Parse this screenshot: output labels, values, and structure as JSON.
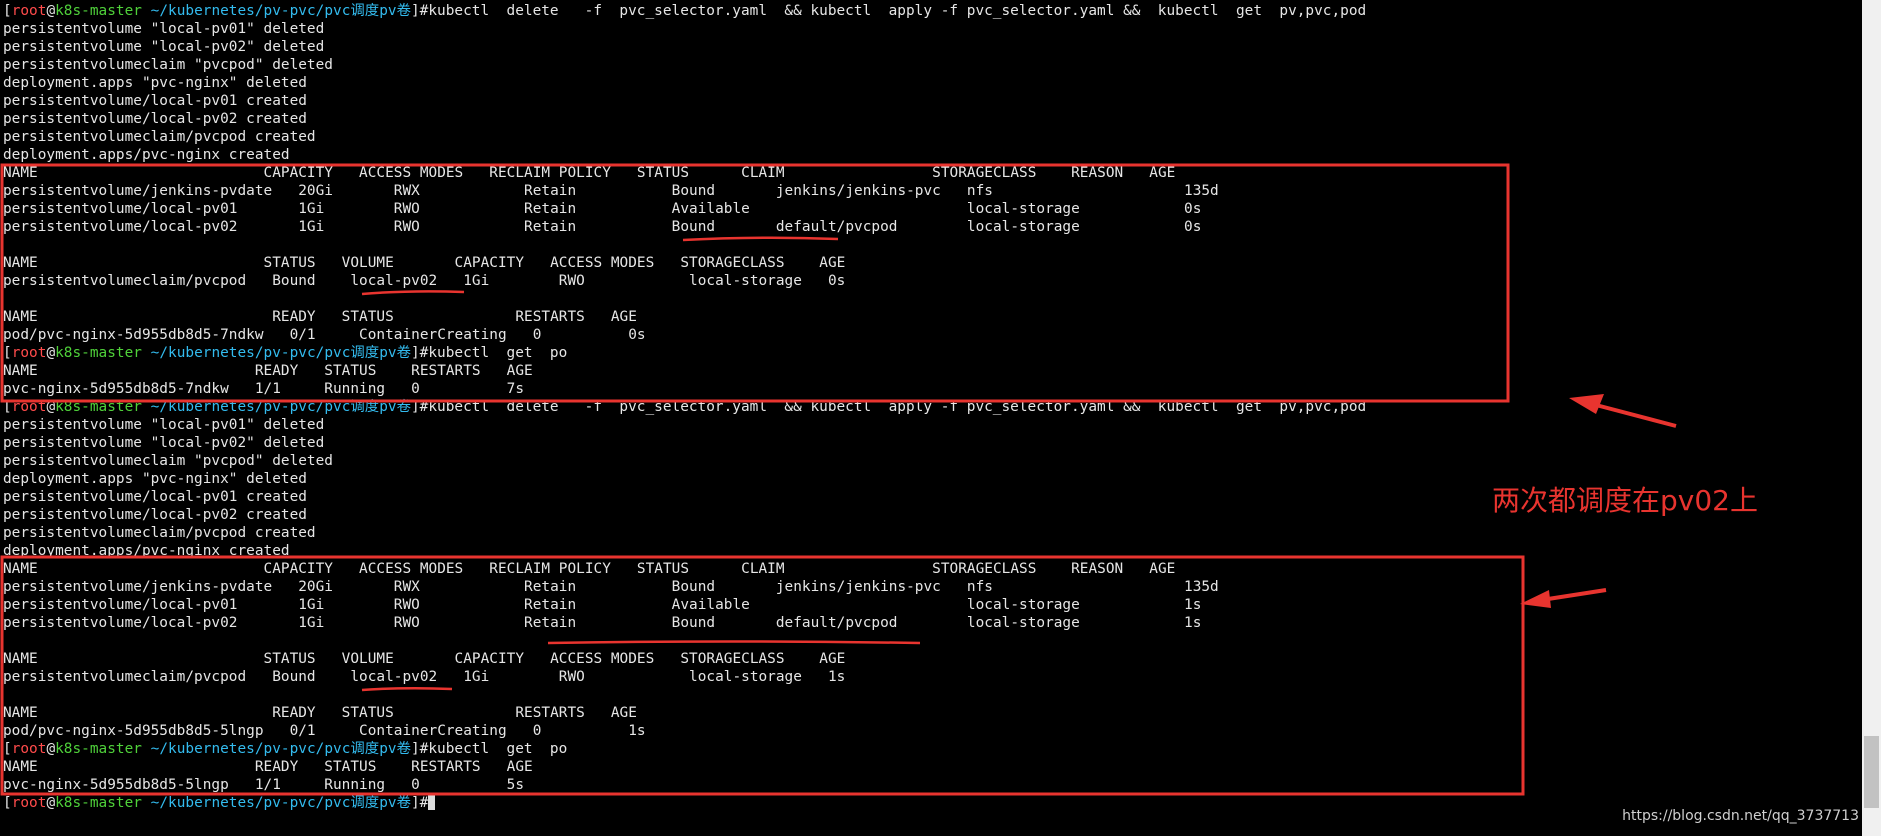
{
  "terminal": {
    "prompt": {
      "open": "[",
      "user": "root",
      "at": "@",
      "host": "k8s-master",
      "path": " ~/kubernetes/pv-pvc/pvc调度pv卷",
      "close": "]#"
    },
    "commands": {
      "apply": "kubectl  delete   -f  pvc_selector.yaml  && kubectl  apply -f pvc_selector.yaml &&  kubectl  get  pv,pvc,pod",
      "get_po": "kubectl  get  po"
    },
    "run1": {
      "out": [
        "persistentvolume \"local-pv01\" deleted",
        "persistentvolume \"local-pv02\" deleted",
        "persistentvolumeclaim \"pvcpod\" deleted",
        "deployment.apps \"pvc-nginx\" deleted",
        "persistentvolume/local-pv01 created",
        "persistentvolume/local-pv02 created",
        "persistentvolumeclaim/pvcpod created",
        "deployment.apps/pvc-nginx created"
      ],
      "pv": [
        "NAME                          CAPACITY   ACCESS MODES   RECLAIM POLICY   STATUS      CLAIM                 STORAGECLASS    REASON   AGE",
        "persistentvolume/jenkins-pvdate   20Gi       RWX            Retain           Bound       jenkins/jenkins-pvc   nfs                      135d",
        "persistentvolume/local-pv01       1Gi        RWO            Retain           Available                         local-storage            0s",
        "persistentvolume/local-pv02       1Gi        RWO            Retain           Bound       default/pvcpod        local-storage            0s"
      ],
      "pvc": [
        "NAME                          STATUS   VOLUME       CAPACITY   ACCESS MODES   STORAGECLASS    AGE",
        "persistentvolumeclaim/pvcpod   Bound    local-pv02   1Gi        RWO            local-storage   0s"
      ],
      "pod": [
        "NAME                           READY   STATUS              RESTARTS   AGE",
        "pod/pvc-nginx-5d955db8d5-7ndkw   0/1     ContainerCreating   0          0s"
      ],
      "po": [
        "NAME                         READY   STATUS    RESTARTS   AGE",
        "pvc-nginx-5d955db8d5-7ndkw   1/1     Running   0          7s"
      ]
    },
    "run2": {
      "out": [
        "persistentvolume \"local-pv01\" deleted",
        "persistentvolume \"local-pv02\" deleted",
        "persistentvolumeclaim \"pvcpod\" deleted",
        "deployment.apps \"pvc-nginx\" deleted",
        "persistentvolume/local-pv01 created",
        "persistentvolume/local-pv02 created",
        "persistentvolumeclaim/pvcpod created",
        "deployment.apps/pvc-nginx created"
      ],
      "pv": [
        "NAME                          CAPACITY   ACCESS MODES   RECLAIM POLICY   STATUS      CLAIM                 STORAGECLASS    REASON   AGE",
        "persistentvolume/jenkins-pvdate   20Gi       RWX            Retain           Bound       jenkins/jenkins-pvc   nfs                      135d",
        "persistentvolume/local-pv01       1Gi        RWO            Retain           Available                         local-storage            1s",
        "persistentvolume/local-pv02       1Gi        RWO            Retain           Bound       default/pvcpod        local-storage            1s"
      ],
      "pvc": [
        "NAME                          STATUS   VOLUME       CAPACITY   ACCESS MODES   STORAGECLASS    AGE",
        "persistentvolumeclaim/pvcpod   Bound    local-pv02   1Gi        RWO            local-storage   1s"
      ],
      "pod": [
        "NAME                           READY   STATUS              RESTARTS   AGE",
        "pod/pvc-nginx-5d955db8d5-5lngp   0/1     ContainerCreating   0          1s"
      ],
      "po": [
        "NAME                         READY   STATUS    RESTARTS   AGE",
        "pvc-nginx-5d955db8d5-5lngp   1/1     Running   0          5s"
      ]
    }
  },
  "annotation": {
    "label": "两次都调度在pv02上",
    "color": "#e8342f"
  },
  "watermark": "https://blog.csdn.net/qq_3737713"
}
